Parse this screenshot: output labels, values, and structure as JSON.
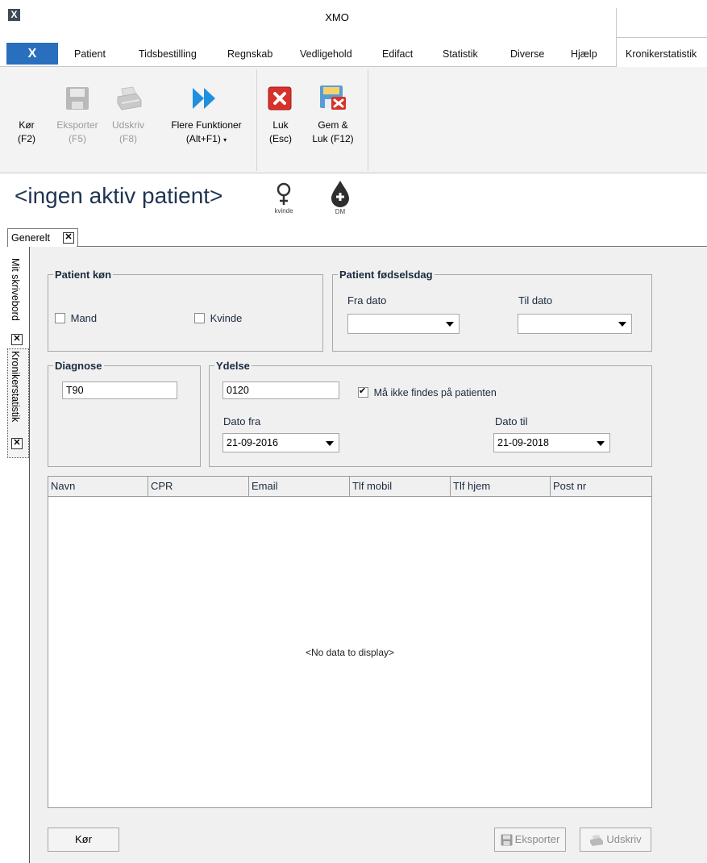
{
  "window": {
    "title": "XMO",
    "logo_letter": "X"
  },
  "menu": {
    "file_tab": "X",
    "items": [
      "Patient",
      "Tidsbestilling",
      "Regnskab",
      "Vedligehold",
      "Edifact",
      "Statistik",
      "Diverse",
      "Hjælp",
      "Kronikerstatistik"
    ]
  },
  "ribbon": {
    "kor": {
      "line1": "Kør",
      "line2": "(F2)"
    },
    "eksporter": {
      "line1": "Eksporter",
      "line2": "(F5)"
    },
    "udskriv": {
      "line1": "Udskriv",
      "line2": "(F8)"
    },
    "flere": {
      "line1": "Flere Funktioner",
      "line2": "(Alt+F1)"
    },
    "luk": {
      "line1": "Luk",
      "line2": "(Esc)"
    },
    "gemluk": {
      "line1": "Gem &",
      "line2": "Luk (F12)"
    }
  },
  "patient_header": {
    "name": "<ingen aktiv patient>",
    "gender_caption": "kvinde",
    "dm_caption": "DM"
  },
  "doc_tab": {
    "label": "Generelt"
  },
  "side_tabs": [
    "Mit skrivebord",
    "Kronikerstatistik"
  ],
  "form": {
    "patient_kon": {
      "legend": "Patient køn",
      "mand": {
        "label": "Mand",
        "checked": false
      },
      "kvinde": {
        "label": "Kvinde",
        "checked": false
      }
    },
    "fodselsdag": {
      "legend": "Patient fødselsdag",
      "fra_label": "Fra dato",
      "til_label": "Til dato",
      "fra_value": "",
      "til_value": ""
    },
    "diagnose": {
      "legend": "Diagnose",
      "value": "T90"
    },
    "ydelse": {
      "legend": "Ydelse",
      "value": "0120",
      "ma_ikke_label": "Må ikke findes på patienten",
      "ma_ikke_checked": true,
      "dato_fra_label": "Dato fra",
      "dato_fra_value": "21-09-2016",
      "dato_til_label": "Dato til",
      "dato_til_value": "21-09-2018"
    }
  },
  "grid": {
    "columns": [
      "Navn",
      "CPR",
      "Email",
      "Tlf mobil",
      "Tlf hjem",
      "Post nr"
    ],
    "empty_text": "<No data to display>"
  },
  "bottom_buttons": {
    "kor": "Kør",
    "eksporter": "Eksporter",
    "udskriv": "Udskriv"
  },
  "colors": {
    "accent": "#2a6ebe",
    "title_text": "#1f3552",
    "arrow_blue": "#1f8fe0",
    "close_red": "#d9302a"
  }
}
